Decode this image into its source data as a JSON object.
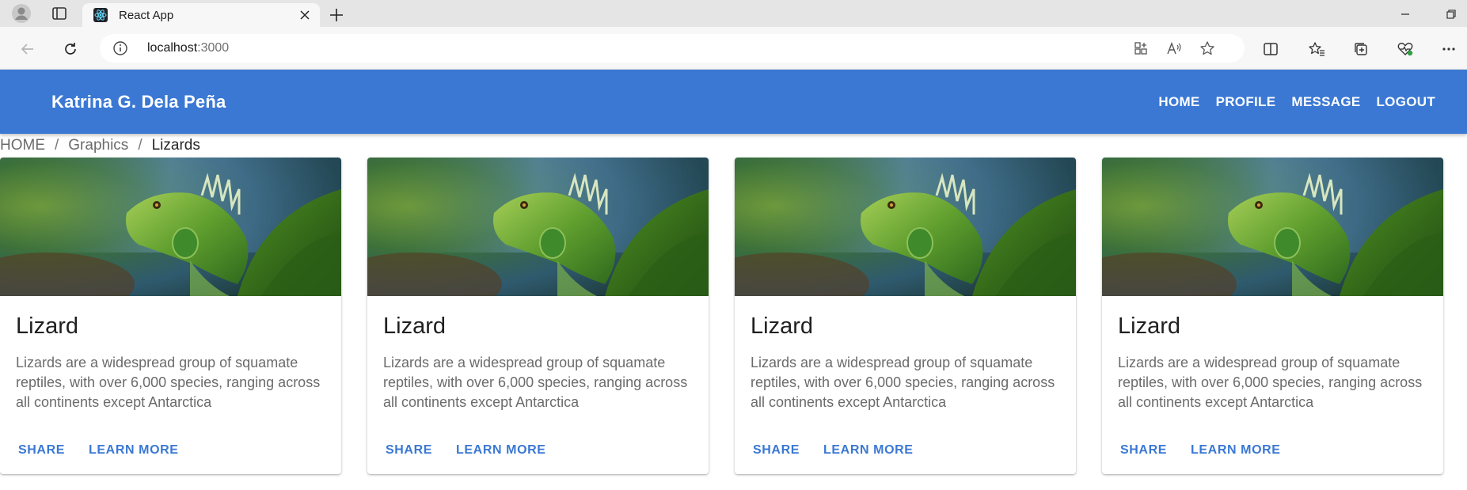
{
  "browser": {
    "tab_title": "React App",
    "address_host": "localhost",
    "address_port": ":3000"
  },
  "app": {
    "brand": "Katrina G. Dela Peña",
    "nav": [
      "HOME",
      "PROFILE",
      "MESSAGE",
      "LOGOUT"
    ]
  },
  "breadcrumb": {
    "items": [
      "HOME",
      "Graphics",
      "Lizards"
    ],
    "separator": "/"
  },
  "cards": [
    {
      "title": "Lizard",
      "text": "Lizards are a widespread group of squamate reptiles, with over 6,000 species, ranging across all continents except Antarctica",
      "share": "SHARE",
      "learn": "LEARN MORE",
      "image_icon": "iguana-photo"
    },
    {
      "title": "Lizard",
      "text": "Lizards are a widespread group of squamate reptiles, with over 6,000 species, ranging across all continents except Antarctica",
      "share": "SHARE",
      "learn": "LEARN MORE",
      "image_icon": "iguana-photo"
    },
    {
      "title": "Lizard",
      "text": "Lizards are a widespread group of squamate reptiles, with over 6,000 species, ranging across all continents except Antarctica",
      "share": "SHARE",
      "learn": "LEARN MORE",
      "image_icon": "iguana-photo"
    },
    {
      "title": "Lizard",
      "text": "Lizards are a widespread group of squamate reptiles, with over 6,000 species, ranging across all continents except Antarctica",
      "share": "SHARE",
      "learn": "LEARN MORE",
      "image_icon": "iguana-photo"
    }
  ],
  "colors": {
    "appbar": "#3a78d4",
    "accent": "#3a78d4"
  }
}
